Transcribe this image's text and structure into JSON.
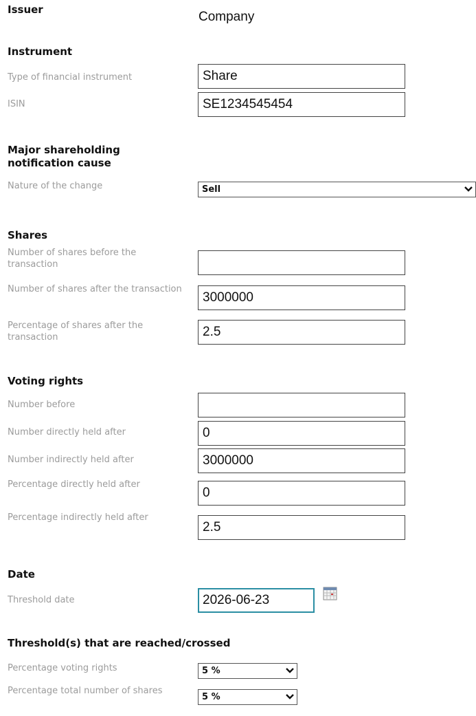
{
  "issuer": {
    "heading": "Issuer",
    "value": "Company"
  },
  "instrument": {
    "heading": "Instrument",
    "type_label": "Type of financial instrument",
    "type_value": "Share",
    "isin_label": "ISIN",
    "isin_value": "SE1234545454"
  },
  "cause": {
    "heading": "Major shareholding notification cause",
    "nature_label": "Nature of the change",
    "nature_value": "Sell"
  },
  "shares": {
    "heading": "Shares",
    "before_label": "Number of shares before the transaction",
    "before_value": "",
    "after_label": "Number of shares after the transaction",
    "after_value": "3000000",
    "pct_after_label": "Percentage of shares after the transaction",
    "pct_after_value": "2.5"
  },
  "voting": {
    "heading": "Voting rights",
    "before_label": "Number before",
    "before_value": "",
    "direct_label": "Number directly held after",
    "direct_value": "0",
    "indirect_label": "Number indirectly held after",
    "indirect_value": "3000000",
    "pct_direct_label": "Percentage directly held after",
    "pct_direct_value": "0",
    "pct_indirect_label": "Percentage indirectly held after",
    "pct_indirect_value": "2.5"
  },
  "date": {
    "heading": "Date",
    "threshold_label": "Threshold date",
    "threshold_value": "2026-06-23"
  },
  "threshold": {
    "heading": "Threshold(s) that are reached/crossed",
    "voting_label": "Percentage voting rights",
    "voting_value": "5 %",
    "total_label": "Percentage total number of shares",
    "total_value": "5 %"
  },
  "icons": {
    "calendar": "calendar-icon",
    "dropdown": "chevron-down-icon"
  },
  "colors": {
    "label": "#9b9b9b",
    "heading": "#111111",
    "focus_border": "#2a8ea3",
    "input_border": "#444444"
  }
}
